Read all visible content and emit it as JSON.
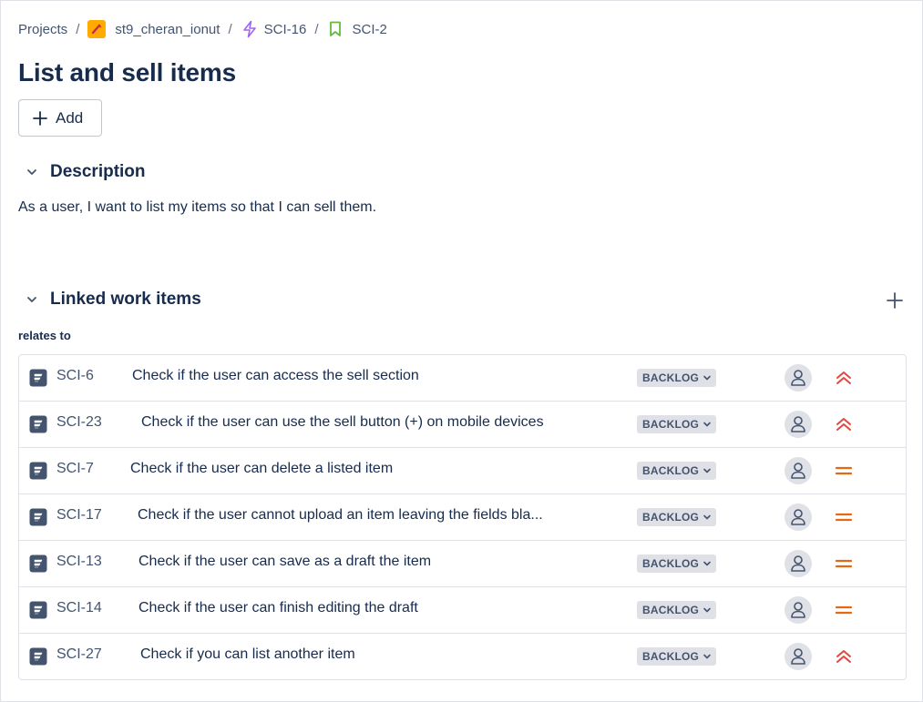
{
  "breadcrumb": {
    "projects": "Projects",
    "separator": "/",
    "project": "st9_cheran_ionut",
    "epic": "SCI-16",
    "story": "SCI-2",
    "colors": {
      "project_avatar": "#ffab00",
      "epic_icon": "#9f64f2",
      "story_icon": "#63ba3c"
    }
  },
  "title": "List and sell items",
  "add_button": {
    "label": "Add",
    "icon": "plus-icon"
  },
  "description": {
    "heading": "Description",
    "text": "As a user, I want to list my items so that I can sell them."
  },
  "linked": {
    "heading": "Linked work items",
    "relation": "relates to",
    "items": [
      {
        "key": "SCI-6",
        "summary": "Check if the user can access the sell section",
        "status": "BACKLOG",
        "priority": "high"
      },
      {
        "key": "SCI-23",
        "summary": "Check if the user can use the sell button (+) on mobile devices",
        "status": "BACKLOG",
        "priority": "high"
      },
      {
        "key": "SCI-7",
        "summary": "Check if the user can delete a listed item",
        "status": "BACKLOG",
        "priority": "medium"
      },
      {
        "key": "SCI-17",
        "summary": "Check if the user cannot upload an item leaving the fields bla...",
        "status": "BACKLOG",
        "priority": "medium"
      },
      {
        "key": "SCI-13",
        "summary": "Check if the user can save as a draft the item",
        "status": "BACKLOG",
        "priority": "medium"
      },
      {
        "key": "SCI-14",
        "summary": "Check if the user can finish editing the draft",
        "status": "BACKLOG",
        "priority": "medium"
      },
      {
        "key": "SCI-27",
        "summary": "Check if you can list another item",
        "status": "BACKLOG",
        "priority": "high"
      }
    ]
  },
  "colors": {
    "priority_high": "#e2483d",
    "priority_medium": "#e56910",
    "test_icon": "#44546f"
  }
}
